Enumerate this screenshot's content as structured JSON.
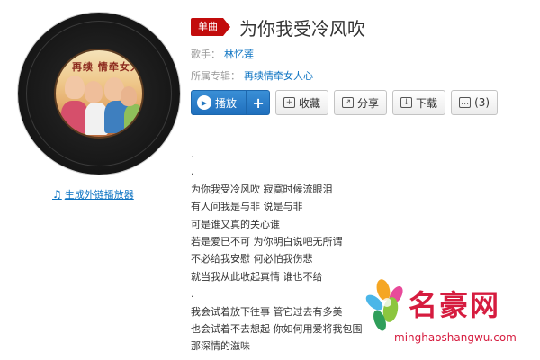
{
  "song": {
    "tag": "单曲",
    "title": "为你我受冷风吹",
    "singer_label": "歌手：",
    "singer": "林忆莲",
    "album_label": "所属专辑：",
    "album": "再续情牵女人心"
  },
  "cover": {
    "title_text": "再续 情牵女人心"
  },
  "player_link": "生成外链播放器",
  "actions": {
    "play": "播放",
    "add": "+",
    "collect": "收藏",
    "share": "分享",
    "download": "下载",
    "comments": "(3)"
  },
  "lyrics": [
    ".",
    ".",
    "为你我受冷风吹 寂寞时候流眼泪",
    "有人问我是与非 说是与非",
    "可是谁又真的关心谁",
    "若是爱已不可 为你明白说吧无所谓",
    "不必给我安慰 何必怕我伤悲",
    "就当我从此收起真情 谁也不给",
    ".",
    "我会试着放下往事 管它过去有多美",
    "也会试着不去想起 你如何用爱将我包围",
    "那深情的滋味"
  ],
  "watermark": {
    "text": "名豪网",
    "url": "minghaoshangwu.com"
  },
  "colors": {
    "accent_red": "#c20c0c",
    "link_blue": "#0c73c2",
    "play_blue": "#2176c0",
    "watermark_red": "#d61c3f"
  }
}
